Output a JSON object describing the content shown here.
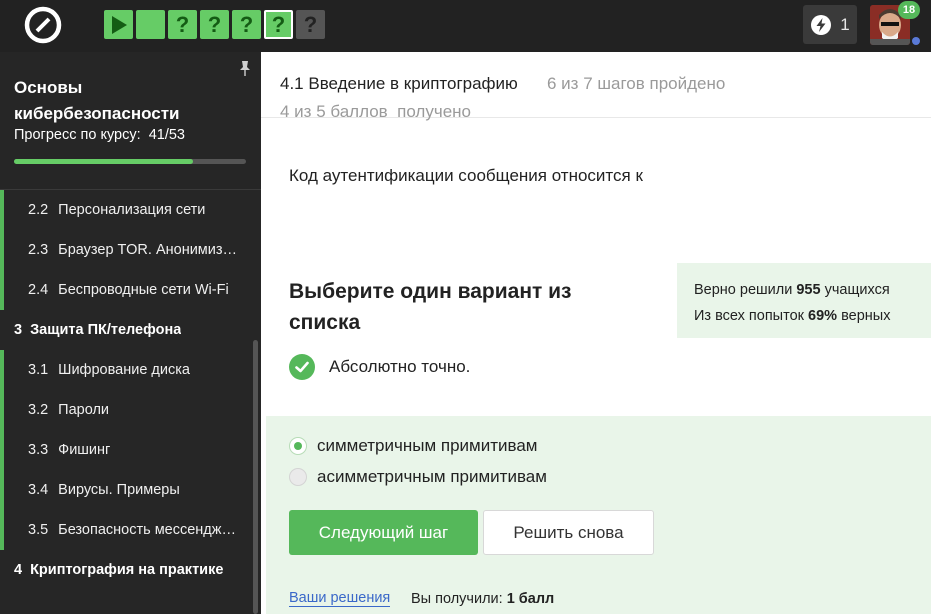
{
  "colors": {
    "accent": "#55b85a",
    "topbar": "#222222",
    "sidebar": "#262626",
    "answer_bg": "#e9f5e9"
  },
  "topbar": {
    "logo_icon": "stepik-logo",
    "steps": [
      {
        "type": "theory",
        "icon": "play-icon",
        "status": "done"
      },
      {
        "type": "blank",
        "status": "done"
      },
      {
        "type": "quiz",
        "label": "?",
        "status": "done"
      },
      {
        "type": "quiz",
        "label": "?",
        "status": "done"
      },
      {
        "type": "quiz",
        "label": "?",
        "status": "done"
      },
      {
        "type": "quiz",
        "label": "?",
        "status": "current"
      },
      {
        "type": "quiz",
        "label": "?",
        "status": "todo"
      }
    ],
    "energy_count": "1",
    "avatar_badge": "18"
  },
  "sidebar": {
    "course_title": "Основы кибербезопасности",
    "progress_label": "Прогресс по курсу:",
    "progress_value": "41/53",
    "progress_fraction": 0.7736,
    "items": [
      {
        "kind": "lesson",
        "num": "2.2",
        "label": "Персонализация сети"
      },
      {
        "kind": "lesson",
        "num": "2.3",
        "label": "Браузер TOR. Анонимизация"
      },
      {
        "kind": "lesson",
        "num": "2.4",
        "label": "Беспроводные сети Wi-Fi"
      },
      {
        "kind": "module",
        "num": "3",
        "label": "Защита ПК/телефона"
      },
      {
        "kind": "lesson",
        "num": "3.1",
        "label": "Шифрование диска"
      },
      {
        "kind": "lesson",
        "num": "3.2",
        "label": "Пароли"
      },
      {
        "kind": "lesson",
        "num": "3.3",
        "label": "Фишинг"
      },
      {
        "kind": "lesson",
        "num": "3.4",
        "label": "Вирусы. Примеры"
      },
      {
        "kind": "lesson",
        "num": "3.5",
        "label": "Безопасность мессенджеров"
      },
      {
        "kind": "module",
        "num": "4",
        "label": "Криптография на практике"
      }
    ]
  },
  "main": {
    "lesson_title": "4.1 Введение в криптографию",
    "steps_passed": "6 из 7 шагов пройдено",
    "score": "4 из 5 баллов  получено",
    "question": "Код аутентификации сообщения относится к",
    "choose_title": "Выберите один вариант из списка",
    "stats": {
      "line1_pre": "Верно решили",
      "line1_num": "955",
      "line1_post": "учащихся",
      "line2_pre": "Из всех попыток",
      "line2_num": "69%",
      "line2_post": "верных"
    },
    "feedback": "Абсолютно точно.",
    "options": [
      {
        "label": "симметричным примитивам",
        "checked": true
      },
      {
        "label": "асимметричным примитивам",
        "checked": false
      }
    ],
    "next_button": "Следующий шаг",
    "retry_button": "Решить снова",
    "solutions_link": "Ваши решения",
    "got_label": "Вы получили:",
    "got_value": "1 балл"
  }
}
